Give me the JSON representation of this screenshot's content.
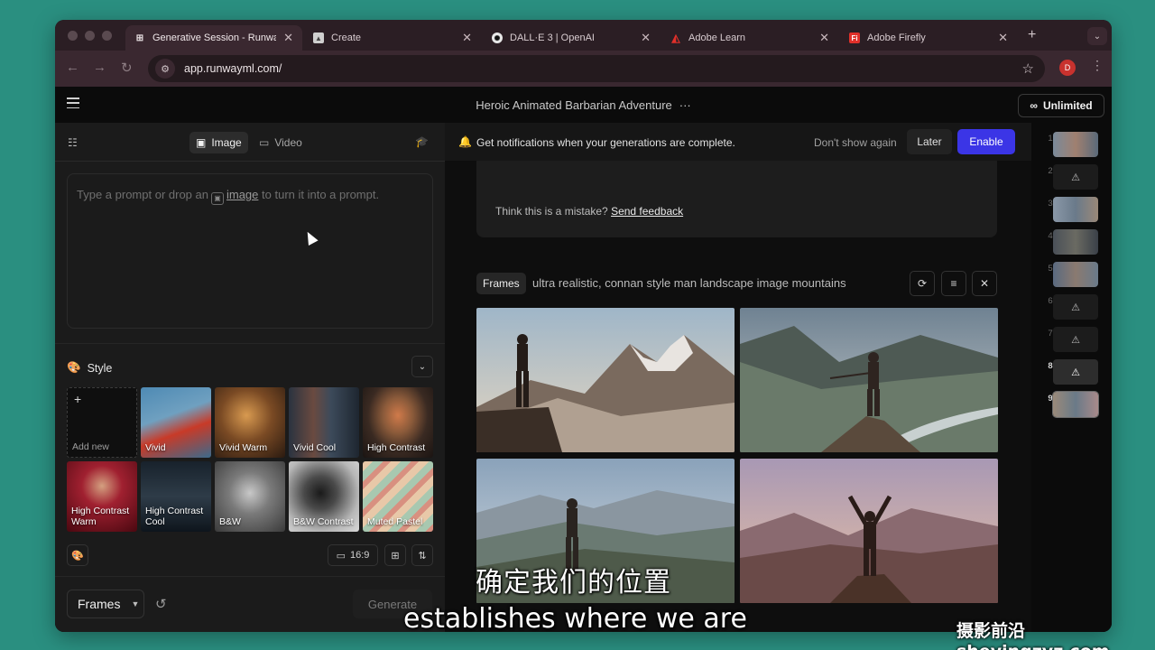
{
  "browser": {
    "tabs": [
      {
        "title": "Generative Session - Runwa",
        "favicon": "runway-icon",
        "active": true
      },
      {
        "title": "Create",
        "favicon": "create-icon",
        "active": false
      },
      {
        "title": "DALL·E 3 | OpenAI",
        "favicon": "openai-icon",
        "active": false
      },
      {
        "title": "Adobe Learn",
        "favicon": "adobe-icon",
        "active": false
      },
      {
        "title": "Adobe Firefly",
        "favicon": "firefly-icon",
        "active": false
      }
    ],
    "new_tab": "+",
    "url": "app.runwayml.com/",
    "profile_initial": "D",
    "firefly_badge": "Fi"
  },
  "app": {
    "session_title": "Heroic Animated Barbarian Adventure",
    "more": "···",
    "plan_label": "Unlimited"
  },
  "left": {
    "tabs": [
      {
        "label": "Image",
        "active": true
      },
      {
        "label": "Video",
        "active": false
      }
    ],
    "prompt_text_1": "Type a prompt or drop an",
    "prompt_link": "image",
    "prompt_text_2": "to turn it into a prompt.",
    "style_label": "Style",
    "styles": [
      "Add new",
      "Vivid",
      "Vivid Warm",
      "Vivid Cool",
      "High Contrast",
      "High Contrast Warm",
      "High Contrast Cool",
      "B&W",
      "B&W Contrast",
      "Muted Pastel"
    ],
    "aspect_ratio": "16:9",
    "mode_select": "Frames",
    "generate_label": "Generate"
  },
  "notification": {
    "message": "Get notifications when your generations are complete.",
    "dismiss": "Don't show again",
    "later": "Later",
    "enable": "Enable"
  },
  "error": {
    "text": "Think this is a mistake?",
    "link": "Send feedback"
  },
  "generation": {
    "tag": "Frames",
    "prompt": "ultra realistic, connan style man landscape image mountains"
  },
  "rail": {
    "items": [
      {
        "num": "1",
        "kind": "thumb"
      },
      {
        "num": "2",
        "kind": "warning"
      },
      {
        "num": "3",
        "kind": "thumb"
      },
      {
        "num": "4",
        "kind": "thumb"
      },
      {
        "num": "5",
        "kind": "thumb"
      },
      {
        "num": "6",
        "kind": "warning"
      },
      {
        "num": "7",
        "kind": "warning"
      },
      {
        "num": "8",
        "kind": "warning"
      },
      {
        "num": "9",
        "kind": "thumb"
      }
    ]
  },
  "overlay": {
    "subtitle_cn": "确定我们的位置",
    "subtitle_en": "establishes where we are",
    "watermark": "摄影前沿 sheyingzyz.com"
  },
  "colors": {
    "accent": "#3b35e6",
    "background": "#2a8f80",
    "app_bg": "#0e0e0e",
    "panel_bg": "#1b1b1b"
  }
}
